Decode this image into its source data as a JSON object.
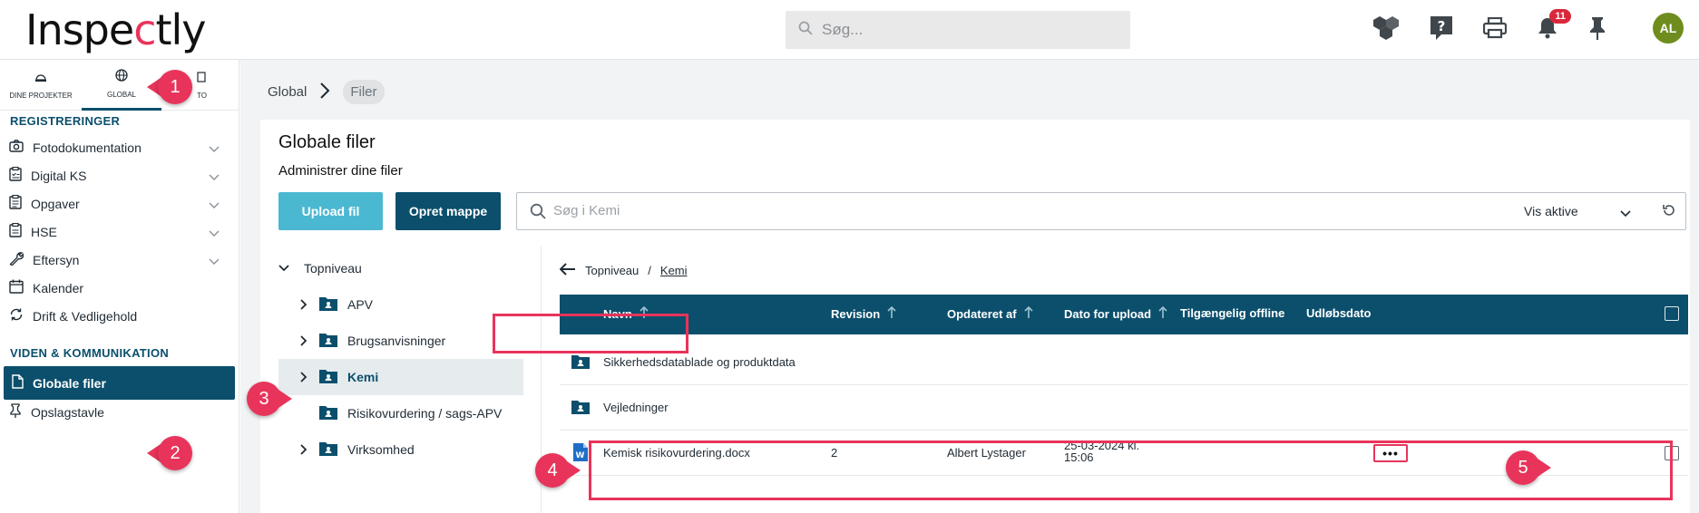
{
  "header": {
    "logo": {
      "pre": "Inspe",
      "accent": "c",
      "post": "tly"
    },
    "search_placeholder": "Søg...",
    "notification_count": "11",
    "avatar_initials": "AL"
  },
  "sidebar": {
    "tabs": [
      {
        "label": "DINE PROJEKTER",
        "icon": "hard-hat-icon"
      },
      {
        "label": "GLOBAL",
        "icon": "globe-icon"
      },
      {
        "label": "TO",
        "icon": "building-icon"
      }
    ],
    "sections": [
      {
        "title": "REGISTRERINGER",
        "items": [
          {
            "label": "Fotodokumentation",
            "icon": "camera-icon",
            "expandable": true
          },
          {
            "label": "Digital KS",
            "icon": "clipboard-check-icon",
            "expandable": true
          },
          {
            "label": "Opgaver",
            "icon": "clipboard-list-icon",
            "expandable": true
          },
          {
            "label": "HSE",
            "icon": "clipboard-icon",
            "expandable": true
          },
          {
            "label": "Eftersyn",
            "icon": "wrench-icon",
            "expandable": true
          },
          {
            "label": "Kalender",
            "icon": "calendar-icon",
            "expandable": false
          },
          {
            "label": "Drift & Vedligehold",
            "icon": "sync-icon",
            "expandable": false
          }
        ]
      },
      {
        "title": "VIDEN & KOMMUNIKATION",
        "items": [
          {
            "label": "Globale filer",
            "icon": "file-icon",
            "active": true
          },
          {
            "label": "Opslagstavle",
            "icon": "pin-icon"
          }
        ]
      }
    ]
  },
  "breadcrumb": {
    "root": "Global",
    "current": "Filer"
  },
  "page": {
    "title": "Globale filer",
    "subtitle": "Administrer dine filer",
    "upload_label": "Upload fil",
    "create_folder_label": "Opret mappe",
    "search_placeholder": "Søg i Kemi",
    "filter_value": "Vis aktive"
  },
  "tree": {
    "root": "Topniveau",
    "folders": [
      {
        "label": "APV",
        "expandable": true
      },
      {
        "label": "Brugsanvisninger",
        "expandable": true
      },
      {
        "label": "Kemi",
        "expandable": true,
        "selected": true
      },
      {
        "label": "Risikovurdering / sags-APV",
        "expandable": false
      },
      {
        "label": "Virksomhed",
        "expandable": true
      }
    ]
  },
  "files": {
    "path_root": "Topniveau",
    "path_separator": "/",
    "path_current": "Kemi",
    "columns": {
      "name": "Navn",
      "revision": "Revision",
      "updated_by": "Opdateret af",
      "upload_date": "Dato for upload",
      "offline": "Tilgængelig offline",
      "expiry": "Udløbsdato"
    },
    "rows": [
      {
        "type": "folder",
        "name": "Sikkerhedsdatablade og produktdata"
      },
      {
        "type": "folder",
        "name": "Vejledninger"
      },
      {
        "type": "word-file",
        "name": "Kemisk risikovurdering.docx",
        "revision": "2",
        "updated_by": "Albert Lystager",
        "upload_date_line1": "25-03-2024 kl.",
        "upload_date_line2": "15:06",
        "more": "•••"
      }
    ]
  },
  "annotations": [
    "1",
    "2",
    "3",
    "4",
    "5"
  ],
  "colors": {
    "brand": "#0b4f6c",
    "accent": "#e8345b",
    "upload": "#4bb8d2"
  }
}
